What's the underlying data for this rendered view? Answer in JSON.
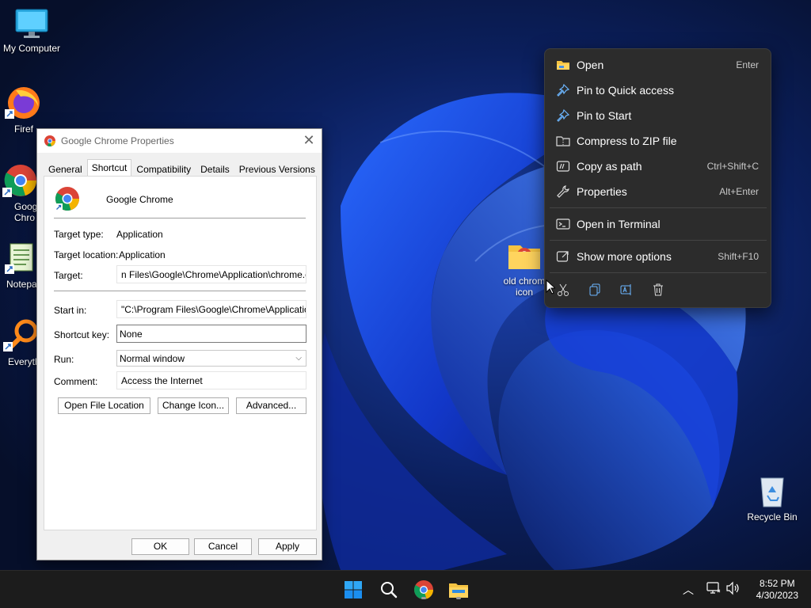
{
  "desktop": {
    "icons": [
      {
        "name": "my-computer",
        "label": "My Computer"
      },
      {
        "name": "firefox",
        "label": "Firef"
      },
      {
        "name": "chrome",
        "label": "Goog\nChro"
      },
      {
        "name": "notepad",
        "label": "Notepa"
      },
      {
        "name": "everything",
        "label": "Everyth"
      },
      {
        "name": "old-chrome-icon",
        "label": "old chrom\nicon"
      },
      {
        "name": "recycle-bin",
        "label": "Recycle Bin"
      }
    ]
  },
  "dialog": {
    "title": "Google Chrome Properties",
    "tabs": [
      "General",
      "Shortcut",
      "Compatibility",
      "Details",
      "Previous Versions"
    ],
    "active_tab": "Shortcut",
    "app_name": "Google Chrome",
    "target_type_label": "Target type:",
    "target_type_value": "Application",
    "target_location_label": "Target location:",
    "target_location_value": "Application",
    "target_label": "Target:",
    "target_value": "n Files\\Google\\Chrome\\Application\\chrome.exe\"",
    "start_in_label": "Start in:",
    "start_in_value": "\"C:\\Program Files\\Google\\Chrome\\Application\"",
    "shortcut_key_label": "Shortcut key:",
    "shortcut_key_value": "None",
    "run_label": "Run:",
    "run_value": "Normal window",
    "comment_label": "Comment:",
    "comment_value": "Access the Internet",
    "open_file_location": "Open File Location",
    "change_icon": "Change Icon...",
    "advanced": "Advanced...",
    "ok": "OK",
    "cancel": "Cancel",
    "apply": "Apply"
  },
  "context_menu": {
    "items": [
      {
        "icon": "folder-icon",
        "label": "Open",
        "shortcut": "Enter"
      },
      {
        "icon": "pin-icon",
        "label": "Pin to Quick access",
        "shortcut": ""
      },
      {
        "icon": "pin-icon",
        "label": "Pin to Start",
        "shortcut": ""
      },
      {
        "icon": "zip-icon",
        "label": "Compress to ZIP file",
        "shortcut": ""
      },
      {
        "icon": "copy-path-icon",
        "label": "Copy as path",
        "shortcut": "Ctrl+Shift+C"
      },
      {
        "icon": "wrench-icon",
        "label": "Properties",
        "shortcut": "Alt+Enter"
      },
      {
        "icon": "terminal-icon",
        "label": "Open in Terminal",
        "shortcut": ""
      },
      {
        "icon": "share-icon",
        "label": "Show more options",
        "shortcut": "Shift+F10"
      }
    ],
    "quick_actions": [
      "cut-icon",
      "copy-icon",
      "rename-icon",
      "delete-icon"
    ]
  },
  "taskbar": {
    "time": "8:52 PM",
    "date": "4/30/2023",
    "pinned": [
      "start-icon",
      "search-icon",
      "chrome-icon",
      "file-explorer-icon"
    ]
  },
  "colors": {
    "wallpaper_dark": "#071231",
    "wallpaper_blue": "#1a3fd8",
    "menu_bg": "#2c2c2c",
    "accent": "#0078d4"
  }
}
